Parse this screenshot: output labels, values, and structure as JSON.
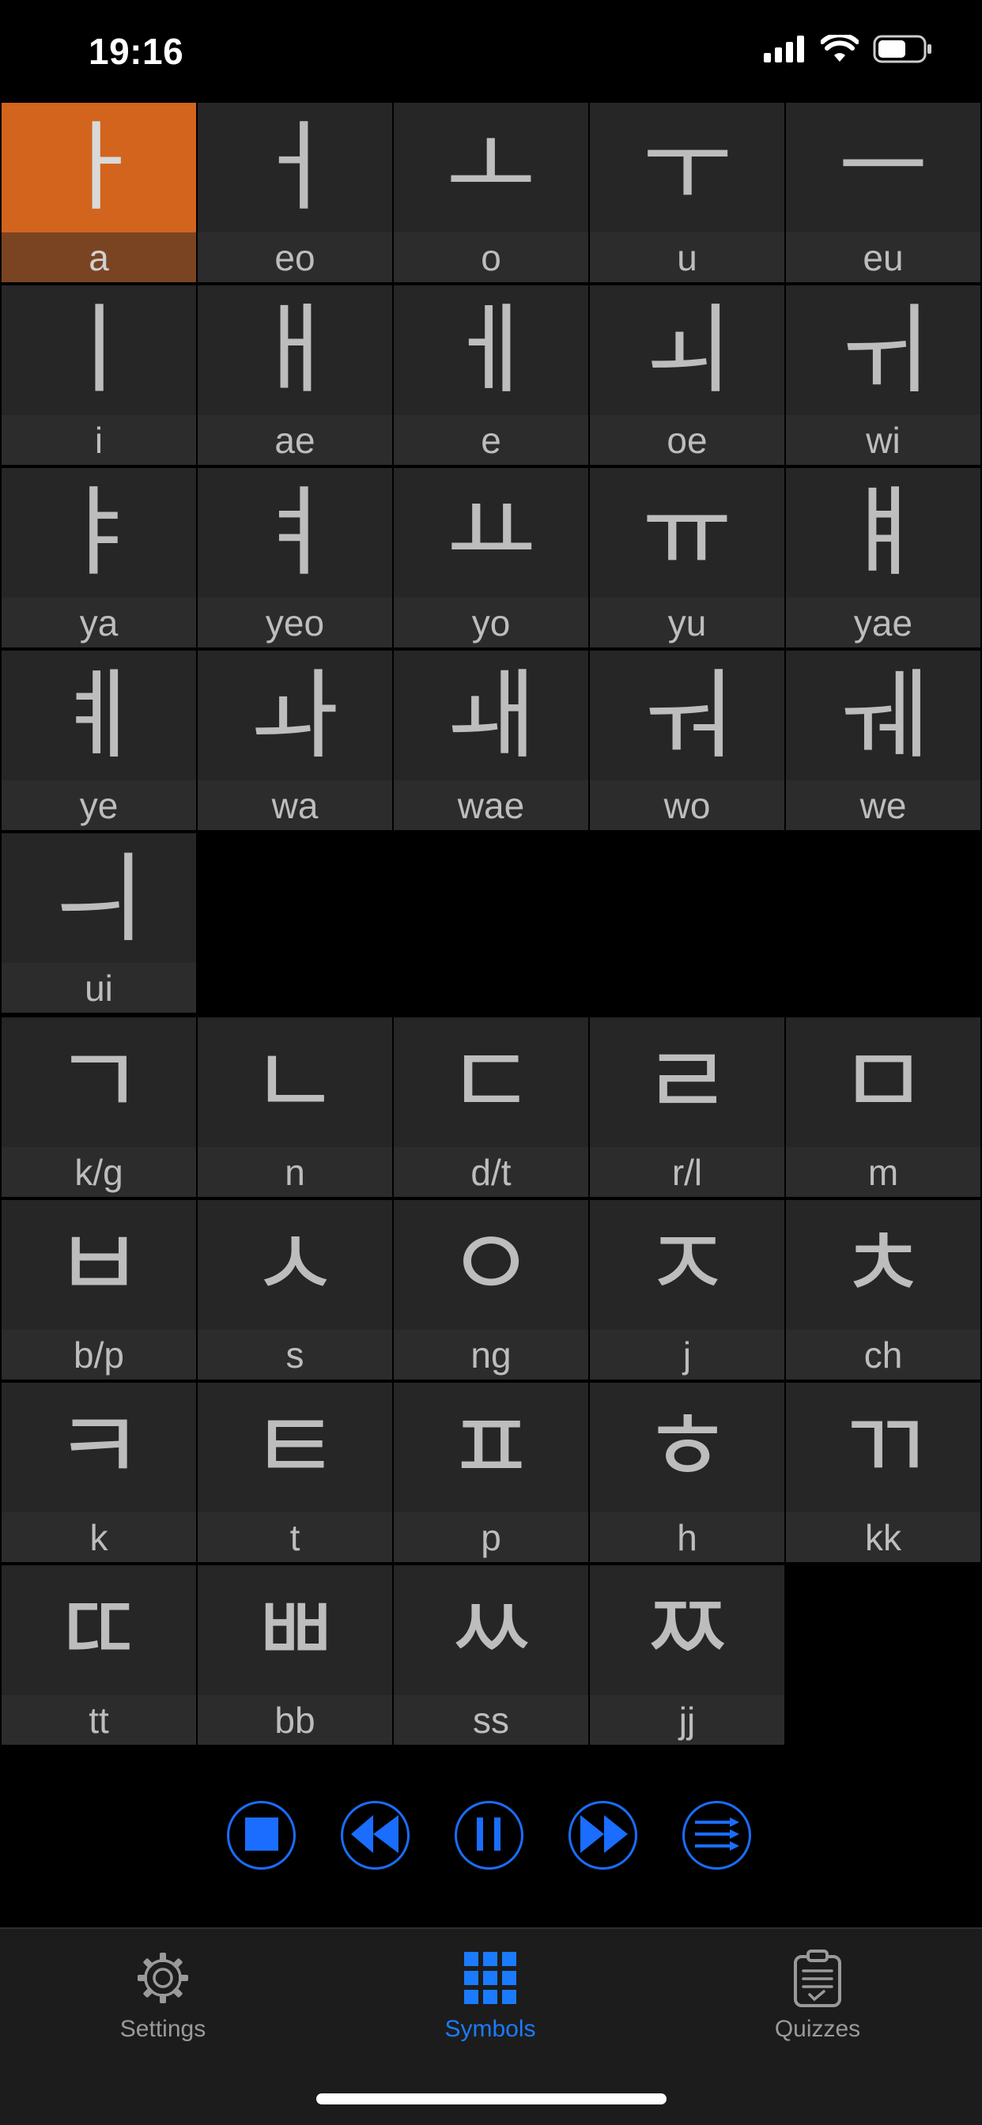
{
  "status": {
    "time": "19:16"
  },
  "vowels": [
    {
      "glyph": "ㅏ",
      "label": "a",
      "selected": true
    },
    {
      "glyph": "ㅓ",
      "label": "eo"
    },
    {
      "glyph": "ㅗ",
      "label": "o"
    },
    {
      "glyph": "ㅜ",
      "label": "u"
    },
    {
      "glyph": "ㅡ",
      "label": "eu"
    },
    {
      "glyph": "ㅣ",
      "label": "i"
    },
    {
      "glyph": "ㅐ",
      "label": "ae"
    },
    {
      "glyph": "ㅔ",
      "label": "e"
    },
    {
      "glyph": "ㅚ",
      "label": "oe"
    },
    {
      "glyph": "ㅟ",
      "label": "wi"
    },
    {
      "glyph": "ㅑ",
      "label": "ya"
    },
    {
      "glyph": "ㅕ",
      "label": "yeo"
    },
    {
      "glyph": "ㅛ",
      "label": "yo"
    },
    {
      "glyph": "ㅠ",
      "label": "yu"
    },
    {
      "glyph": "ㅒ",
      "label": "yae"
    },
    {
      "glyph": "ㅖ",
      "label": "ye"
    },
    {
      "glyph": "ㅘ",
      "label": "wa"
    },
    {
      "glyph": "ㅙ",
      "label": "wae"
    },
    {
      "glyph": "ㅝ",
      "label": "wo"
    },
    {
      "glyph": "ㅞ",
      "label": "we"
    },
    {
      "glyph": "ㅢ",
      "label": "ui"
    }
  ],
  "consonants": [
    {
      "glyph": "ㄱ",
      "label": "k/g"
    },
    {
      "glyph": "ㄴ",
      "label": "n"
    },
    {
      "glyph": "ㄷ",
      "label": "d/t"
    },
    {
      "glyph": "ㄹ",
      "label": "r/l"
    },
    {
      "glyph": "ㅁ",
      "label": "m"
    },
    {
      "glyph": "ㅂ",
      "label": "b/p"
    },
    {
      "glyph": "ㅅ",
      "label": "s"
    },
    {
      "glyph": "ㅇ",
      "label": "ng"
    },
    {
      "glyph": "ㅈ",
      "label": "j"
    },
    {
      "glyph": "ㅊ",
      "label": "ch"
    },
    {
      "glyph": "ㅋ",
      "label": "k"
    },
    {
      "glyph": "ㅌ",
      "label": "t"
    },
    {
      "glyph": "ㅍ",
      "label": "p"
    },
    {
      "glyph": "ㅎ",
      "label": "h"
    },
    {
      "glyph": "ㄲ",
      "label": "kk"
    },
    {
      "glyph": "ㄸ",
      "label": "tt"
    },
    {
      "glyph": "ㅃ",
      "label": "bb"
    },
    {
      "glyph": "ㅆ",
      "label": "ss"
    },
    {
      "glyph": "ㅉ",
      "label": "jj"
    }
  ],
  "controls": [
    {
      "name": "stop-button",
      "icon": "stop-icon"
    },
    {
      "name": "previous-button",
      "icon": "rewind-icon"
    },
    {
      "name": "pause-button",
      "icon": "pause-icon"
    },
    {
      "name": "next-button",
      "icon": "fast-forward-icon"
    },
    {
      "name": "sequence-button",
      "icon": "list-arrows-icon"
    }
  ],
  "tabs": {
    "settings": "Settings",
    "symbols": "Symbols",
    "quizzes": "Quizzes"
  },
  "colors": {
    "accent": "#1a7bff",
    "selected_cell": "#d2641e",
    "selected_label": "#7a4423",
    "cell": "#262626"
  }
}
